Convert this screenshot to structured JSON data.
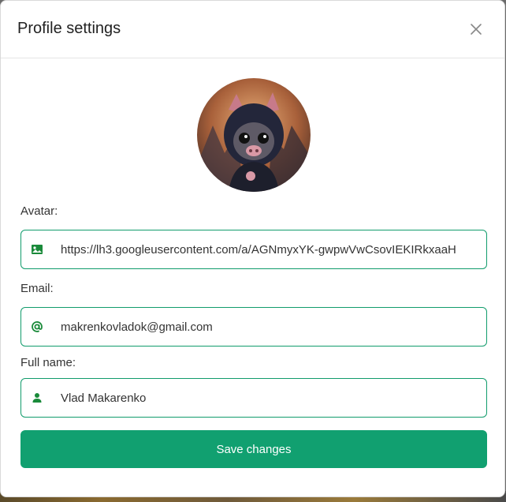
{
  "dialog": {
    "title": "Profile settings",
    "close_icon": "close-icon"
  },
  "avatar": {
    "alt": "pig-in-hood-avatar"
  },
  "form": {
    "avatar_label": "Avatar:",
    "avatar_value": "https://lh3.googleusercontent.com/a/AGNmyxYK-gwpwVwCsovIEKIRkxaaH",
    "avatar_icon": "image-icon",
    "email_label": "Email:",
    "email_value": "makrenkovladok@gmail.com",
    "email_icon": "at-icon",
    "name_label": "Full name:",
    "name_value": "Vlad Makarenko",
    "name_icon": "user-icon",
    "save_label": "Save changes"
  },
  "colors": {
    "accent": "#11a070",
    "field_border": "#119c6c",
    "icon": "#1a8a3a"
  }
}
